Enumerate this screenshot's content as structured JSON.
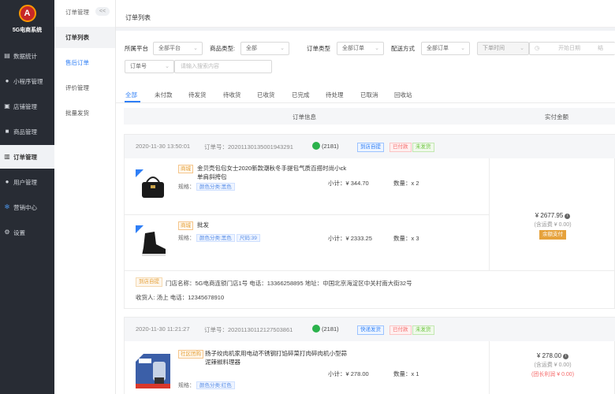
{
  "app": {
    "name": "5G电商系统",
    "logo_char": "A"
  },
  "sidebar": {
    "items": [
      {
        "label": "数据统计",
        "icon": "bar-chart-icon"
      },
      {
        "label": "小程序管理",
        "icon": "person-icon"
      },
      {
        "label": "店铺管理",
        "icon": "store-icon"
      },
      {
        "label": "商品管理",
        "icon": "box-icon"
      },
      {
        "label": "订单管理",
        "icon": "document-icon"
      },
      {
        "label": "用户管理",
        "icon": "user-icon"
      },
      {
        "label": "营销中心",
        "icon": "marketing-icon"
      },
      {
        "label": "设置",
        "icon": "gear-icon"
      }
    ],
    "active_index": 4
  },
  "subnav": {
    "title": "订单管理",
    "toggle": "<<",
    "items": [
      {
        "label": "订单列表"
      },
      {
        "label": "售后订单"
      },
      {
        "label": "评价管理"
      },
      {
        "label": "批量发货"
      }
    ]
  },
  "page": {
    "title": "订单列表"
  },
  "filters": {
    "platform_label": "所属平台",
    "platform_value": "全部平台",
    "category_label": "商品类型:",
    "category_value": "全部",
    "order_type_label": "订单类型",
    "order_type_value": "全部订单",
    "delivery_label": "配送方式",
    "delivery_value": "全部订单",
    "time_type_value": "下单时间",
    "start_date_placeholder": "开始日期",
    "end_date_placeholder": "结",
    "search_field_value": "订单号",
    "search_placeholder": "请输入搜索内容"
  },
  "tabs": [
    "全部",
    "未付款",
    "待发货",
    "待收货",
    "已收货",
    "已完成",
    "待处理",
    "已取消",
    "回收站"
  ],
  "table": {
    "col_info": "订单信息",
    "col_amount": "实付金额"
  },
  "orders": [
    {
      "date": "2020-11-30 13:50:01",
      "order_no": "订单号：20201130135001943291",
      "user": "(2181)",
      "badges": [
        "到店自提",
        "已付款",
        "未发货"
      ],
      "items": [
        {
          "tag": "商城",
          "name": "金贝壳包包女士2020新款潮秋冬手提包气质百搭时尚小ck单肩斜挎包",
          "spec_label": "规格：",
          "specs": [
            "颜色分类:黑色"
          ],
          "subtotal": "小计：¥ 344.70",
          "qty": "数量：x 2"
        },
        {
          "tag": "商城",
          "name": "批发",
          "spec_label": "规格：",
          "specs": [
            "颜色分类:黑色",
            "尺码:39"
          ],
          "subtotal": "小计：¥ 2333.25",
          "qty": "数量：x 3"
        }
      ],
      "amount": "¥ 2677.95",
      "shipping": "(含运费 ¥ 0.00)",
      "pay": "余额支付",
      "pickup_tag": "到店自提",
      "store_line": "门店名称：5G电商连锁门店1号  电话：13366258895  地址：中国北京海淀区中关村南大街32号",
      "receiver_line": "收货人: 汤上  电话：12345678910"
    },
    {
      "date": "2020-11-30 11:21:27",
      "order_no": "订单号：20201130112127503861",
      "user": "(2181)",
      "badges": [
        "快递发货",
        "已付款",
        "未发货"
      ],
      "items": [
        {
          "tag": "社区团购",
          "name": "扬子绞肉机家用电动不锈钢打馅碎菜打肉碎肉机小型蒜泥辣椒料理器",
          "spec_label": "规格：",
          "specs": [
            "颜色分类:红色"
          ],
          "subtotal": "小计：¥ 278.00",
          "qty": "数量：x 1"
        }
      ],
      "amount": "¥ 278.00",
      "shipping": "(含运费 ¥ 0.00)",
      "discount": "(团长利润 ¥ 0.00)"
    }
  ],
  "colors": {
    "accent": "#2f7ff6",
    "sidebar_bg": "#282c34",
    "orange": "#e6a23c",
    "red": "#f56c6c"
  }
}
